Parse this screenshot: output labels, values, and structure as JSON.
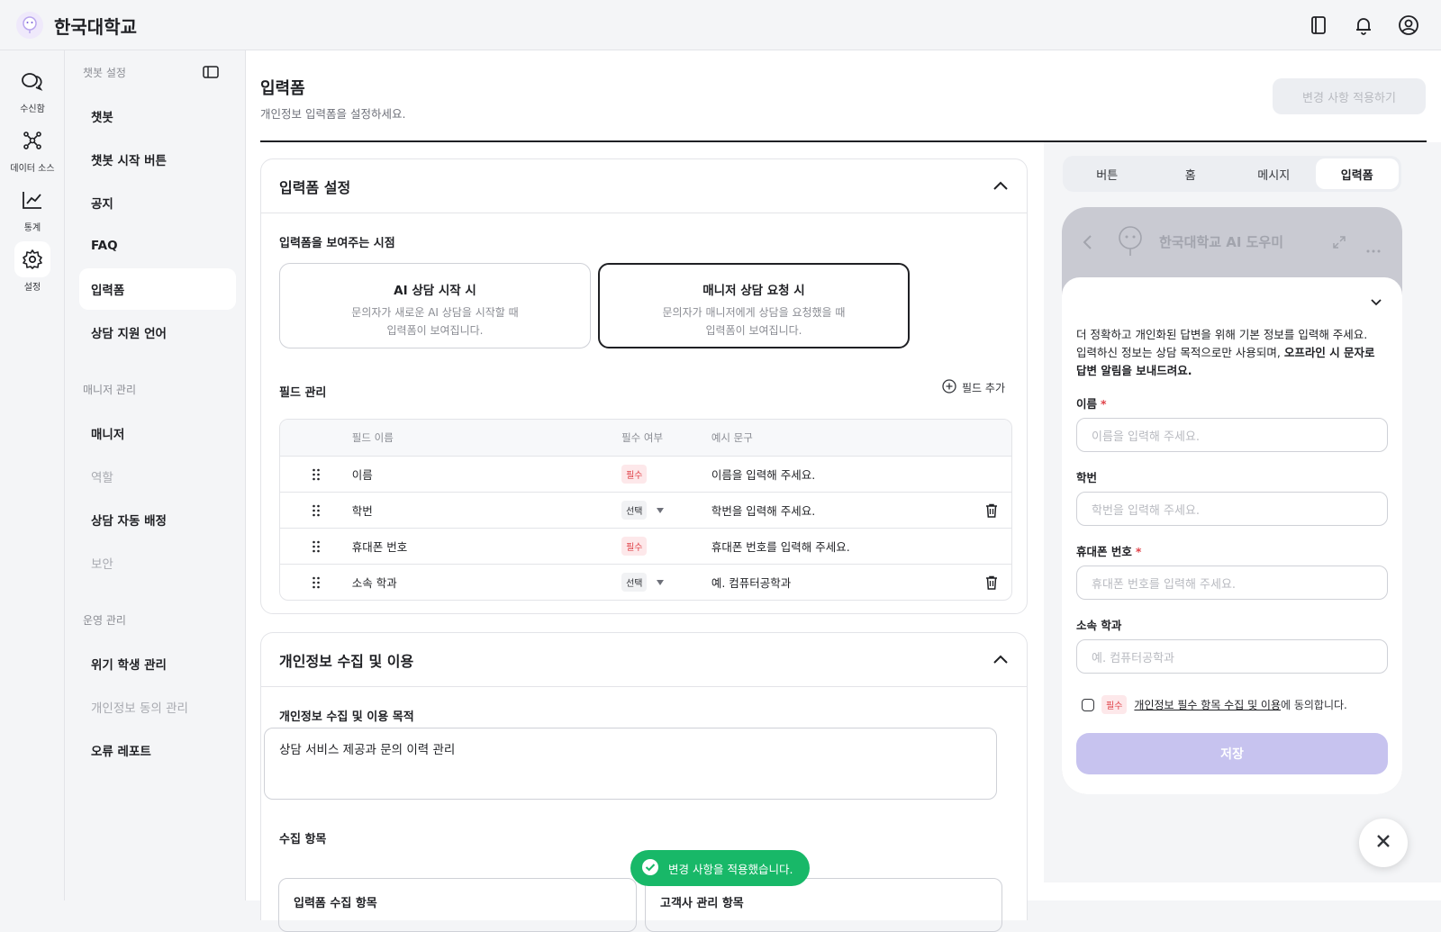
{
  "app": {
    "brand": "한국대학교"
  },
  "rail": [
    {
      "label": "수신함",
      "icon": "inbox-chat-icon"
    },
    {
      "label": "데이터 소스",
      "icon": "data-source-icon"
    },
    {
      "label": "통계",
      "icon": "stats-chart-icon"
    },
    {
      "label": "설정",
      "icon": "gear-icon"
    }
  ],
  "sidebar": {
    "group1": "챗봇 설정",
    "items1": [
      "챗봇",
      "챗봇 시작 버튼",
      "공지",
      "FAQ",
      "입력폼",
      "상담 지원 언어"
    ],
    "group2": "매니저 관리",
    "items2": [
      "매니저",
      "역할",
      "상담 자동 배정",
      "보안"
    ],
    "group3": "운영 관리",
    "items3": [
      "위기 학생 관리",
      "개인정보 동의 관리",
      "오류 레포트"
    ]
  },
  "page": {
    "title": "입력폼",
    "subtitle": "개인정보 입력폼을 설정하세요.",
    "apply_label": "변경 사항 적용하기"
  },
  "form_settings": {
    "title": "입력폼 설정",
    "timing_label": "입력폼을 보여주는 시점",
    "options": [
      {
        "title": "AI 상담 시작 시",
        "desc1": "문의자가 새로운 AI 상담을 시작할 때",
        "desc2": "입력폼이 보여집니다."
      },
      {
        "title": "매니저 상담 요청 시",
        "desc1": "문의자가 매니저에게 상담을 요청했을 때",
        "desc2": "입력폼이 보여집니다."
      }
    ],
    "fields_label": "필드 관리",
    "add_field": "필드 추가",
    "columns": [
      "필드 이름",
      "필수 여부",
      "예시 문구"
    ],
    "rows": [
      {
        "name": "이름",
        "req": "필수",
        "example": "이름을 입력해 주세요."
      },
      {
        "name": "학번",
        "req": "선택",
        "example": "학번을 입력해 주세요."
      },
      {
        "name": "휴대폰 번호",
        "req": "필수",
        "example": "휴대폰 번호를 입력해 주세요."
      },
      {
        "name": "소속 학과",
        "req": "선택",
        "example": "예. 컴퓨터공학과"
      }
    ]
  },
  "privacy": {
    "title": "개인정보 수집 및 이용",
    "purpose_label": "개인정보 수집 및 이용 목적",
    "purpose_value": "상담 서비스 제공과 문의 이력 관리",
    "items_label": "수집 항목",
    "box1": "입력폼 수집 항목",
    "box2": "고객사 관리 항목"
  },
  "preview": {
    "tabs": [
      "버튼",
      "홈",
      "메시지",
      "입력폼"
    ],
    "bot_title": "한국대학교 AI 도우미",
    "intro1": "더 정확하고 개인화된 답변을 위해 기본 정보를 입력해 주세요.",
    "intro2": "입력하신 정보는 상담 목적으로만 사용되며, ",
    "intro_bold": "오프라인 시 문자로 답변 알림을 보내드려요.",
    "fields": [
      {
        "label": "이름",
        "required": true,
        "placeholder": "이름을 입력해 주세요."
      },
      {
        "label": "학번",
        "required": false,
        "placeholder": "학번을 입력해 주세요."
      },
      {
        "label": "휴대폰 번호",
        "required": true,
        "placeholder": "휴대폰 번호를 입력해 주세요."
      },
      {
        "label": "소속 학과",
        "required": false,
        "placeholder": "예. 컴퓨터공학과"
      }
    ],
    "star": "*",
    "consent_badge": "필수",
    "consent_link": "개인정보 필수 항목 수집 및 이용",
    "consent_tail": "에 동의합니다.",
    "save_label": "저장"
  },
  "toast": {
    "message": "변경 사항을 적용했습니다."
  },
  "colors": {
    "accent": "#18b868",
    "required": "#e0434a",
    "save_disabled": "#c7c3ef"
  }
}
